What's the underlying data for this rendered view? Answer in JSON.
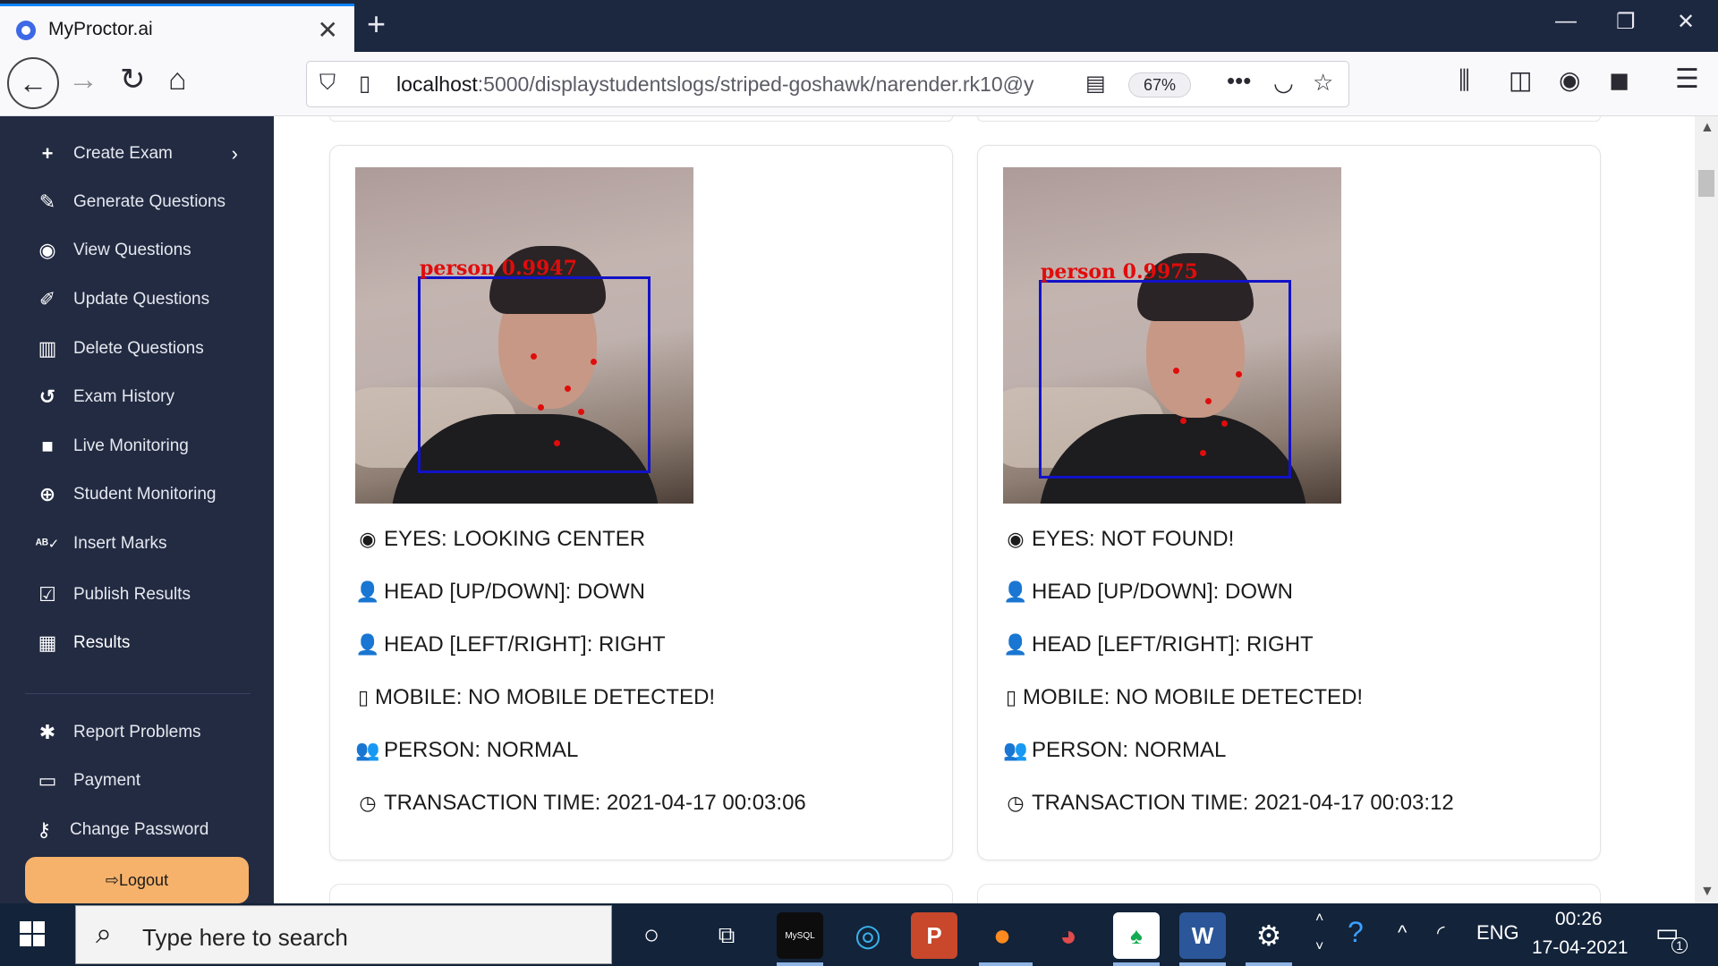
{
  "browser": {
    "tab_title": "MyProctor.ai",
    "url_host": "localhost",
    "url_path": ":5000/displaystudentslogs/striped-goshawk/narender.rk10@y",
    "zoom": "67%"
  },
  "sidebar": {
    "items": [
      {
        "label": "Create Exam",
        "icon": "plus-icon"
      },
      {
        "label": "Generate Questions",
        "icon": "magic-wand-icon"
      },
      {
        "label": "View Questions",
        "icon": "eye-icon"
      },
      {
        "label": "Update Questions",
        "icon": "edit-icon"
      },
      {
        "label": "Delete Questions",
        "icon": "trash-icon"
      },
      {
        "label": "Exam History",
        "icon": "history-icon"
      },
      {
        "label": "Live Monitoring",
        "icon": "video-icon"
      },
      {
        "label": "Student Monitoring",
        "icon": "binoculars-icon"
      },
      {
        "label": "Insert Marks",
        "icon": "spell-check-icon"
      },
      {
        "label": "Publish Results",
        "icon": "clipboard-check-icon"
      },
      {
        "label": "Results",
        "icon": "chart-icon"
      }
    ],
    "bottom_items": [
      {
        "label": "Report Problems",
        "icon": "bug-icon"
      },
      {
        "label": "Payment",
        "icon": "money-icon"
      },
      {
        "label": "Change Password",
        "icon": "key-icon"
      }
    ],
    "logout_label": "Logout"
  },
  "logs": [
    {
      "detection_label": "person 0.9947",
      "eyes": "EYES: LOOKING CENTER",
      "head_ud": "HEAD [UP/DOWN]: DOWN",
      "head_lr": "HEAD [LEFT/RIGHT]: RIGHT",
      "mobile": "MOBILE: NO MOBILE DETECTED!",
      "person": "PERSON: NORMAL",
      "time": "TRANSACTION TIME: 2021-04-17 00:03:06"
    },
    {
      "detection_label": "person 0.9975",
      "eyes": "EYES: NOT FOUND!",
      "head_ud": "HEAD [UP/DOWN]: DOWN",
      "head_lr": "HEAD [LEFT/RIGHT]: RIGHT",
      "mobile": "MOBILE: NO MOBILE DETECTED!",
      "person": "PERSON: NORMAL",
      "time": "TRANSACTION TIME: 2021-04-17 00:03:12"
    }
  ],
  "taskbar": {
    "search_placeholder": "Type here to search",
    "mysql_label": "MySQL",
    "language": "ENG",
    "time": "00:26",
    "date": "17-04-2021",
    "notification_count": "1"
  },
  "colors": {
    "sidebar_bg": "#222b42",
    "logout_bg": "#f6b26b",
    "bbox": "#1212c8",
    "label_red": "#e00c0c"
  }
}
